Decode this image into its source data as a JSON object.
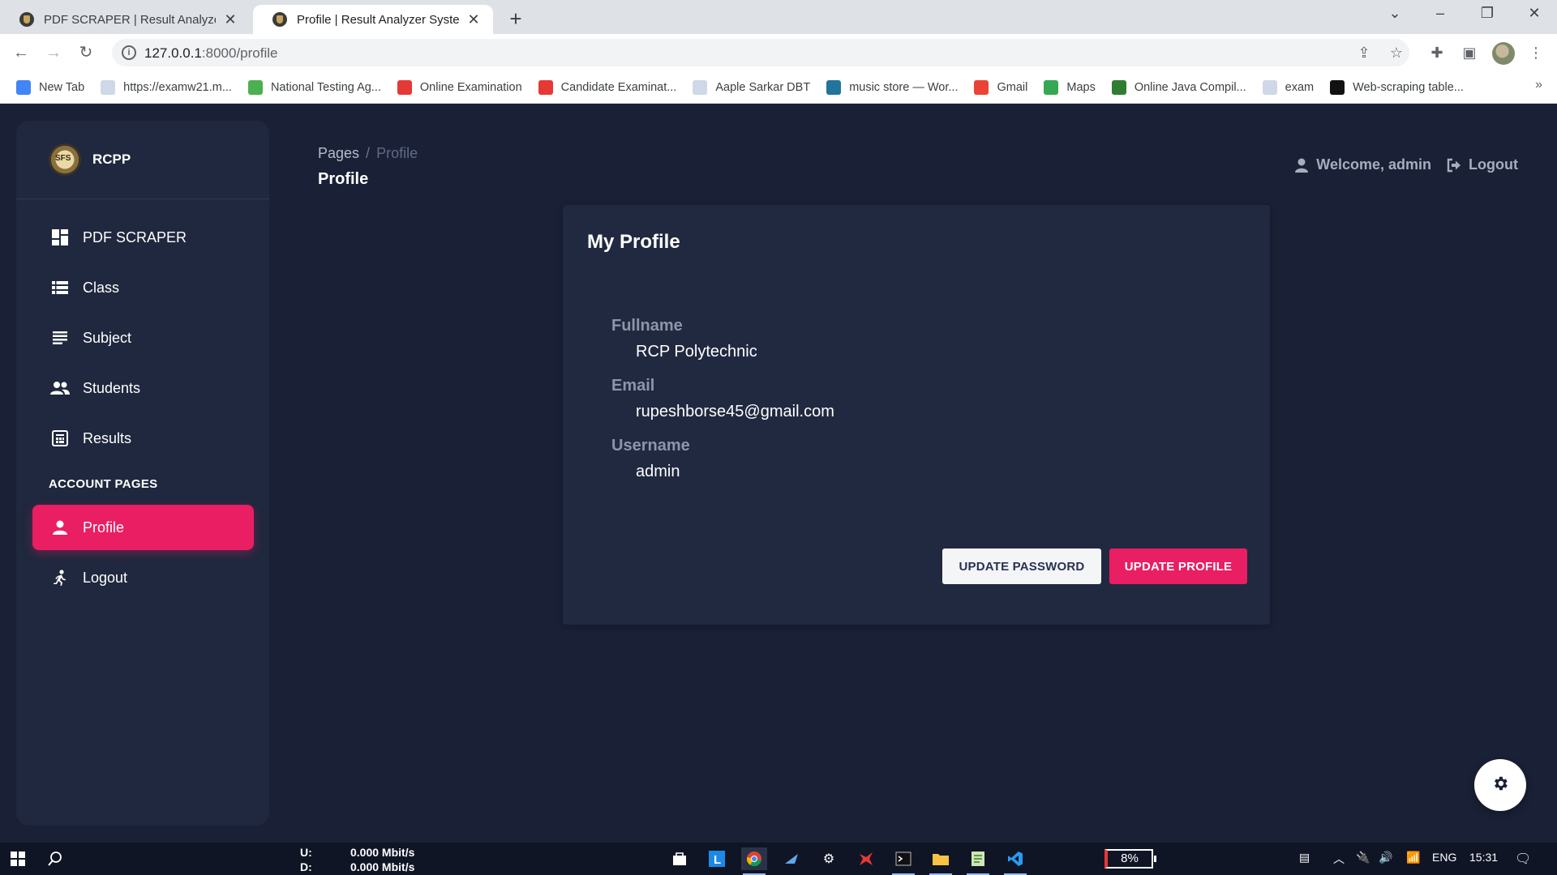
{
  "browser": {
    "tabs": [
      {
        "title": "PDF SCRAPER | Result Analyzer System",
        "active": false
      },
      {
        "title": "Profile | Result Analyzer System",
        "active": true
      }
    ],
    "new_tab_symbol": "+",
    "url_host": "127.0.0.1",
    "url_rest": ":8000/profile",
    "bookmarks": [
      {
        "label": "New Tab",
        "icon": "google-icon",
        "color": "#4285f4"
      },
      {
        "label": "https://examw21.m...",
        "icon": "page-icon",
        "color": "#cfd8e8"
      },
      {
        "label": "National Testing Ag...",
        "icon": "nta-icon",
        "color": "#4caf50"
      },
      {
        "label": "Online Examination",
        "icon": "exam-icon",
        "color": "#e53935"
      },
      {
        "label": "Candidate Examinat...",
        "icon": "exam-icon",
        "color": "#e53935"
      },
      {
        "label": "Aaple Sarkar DBT",
        "icon": "page-icon",
        "color": "#cfd8e8"
      },
      {
        "label": "music store — Wor...",
        "icon": "wordpress-icon",
        "color": "#21759b"
      },
      {
        "label": "Gmail",
        "icon": "gmail-icon",
        "color": "#ea4335"
      },
      {
        "label": "Maps",
        "icon": "maps-icon",
        "color": "#34a853"
      },
      {
        "label": "Online Java Compil...",
        "icon": "code-icon",
        "color": "#2e7d32"
      },
      {
        "label": "exam",
        "icon": "page-icon",
        "color": "#cfd8e8"
      },
      {
        "label": "Web-scraping table...",
        "icon": "medium-icon",
        "color": "#111111"
      }
    ],
    "bookmarks_more": "»"
  },
  "sidebar": {
    "brand": "RCPP",
    "items": [
      {
        "label": "PDF SCRAPER",
        "icon": "dashboard-icon"
      },
      {
        "label": "Class",
        "icon": "table-icon"
      },
      {
        "label": "Subject",
        "icon": "list-icon"
      },
      {
        "label": "Students",
        "icon": "users-icon"
      },
      {
        "label": "Results",
        "icon": "receipt-icon"
      }
    ],
    "section_label": "ACCOUNT PAGES",
    "account_items": [
      {
        "label": "Profile",
        "icon": "user-icon",
        "active": true
      },
      {
        "label": "Logout",
        "icon": "run-icon",
        "active": false
      }
    ]
  },
  "header": {
    "breadcrumb_root": "Pages",
    "breadcrumb_sep": "/",
    "breadcrumb_current": "Profile",
    "title": "Profile",
    "welcome": "Welcome, admin",
    "logout": "Logout"
  },
  "profile": {
    "title": "My Profile",
    "fields": [
      {
        "label": "Fullname",
        "value": "RCP Polytechnic"
      },
      {
        "label": "Email",
        "value": "rupeshborse45@gmail.com"
      },
      {
        "label": "Username",
        "value": "admin"
      }
    ],
    "update_password": "UPDATE PASSWORD",
    "update_profile": "UPDATE PROFILE"
  },
  "taskbar": {
    "net_up_label": "U:",
    "net_up": "0.000 Mbit/s",
    "net_down_label": "D:",
    "net_down": "0.000 Mbit/s",
    "battery": "8%",
    "language": "ENG",
    "time": "15:31"
  },
  "colors": {
    "accent": "#e91e63",
    "background": "#1a2035",
    "card": "#202940"
  }
}
